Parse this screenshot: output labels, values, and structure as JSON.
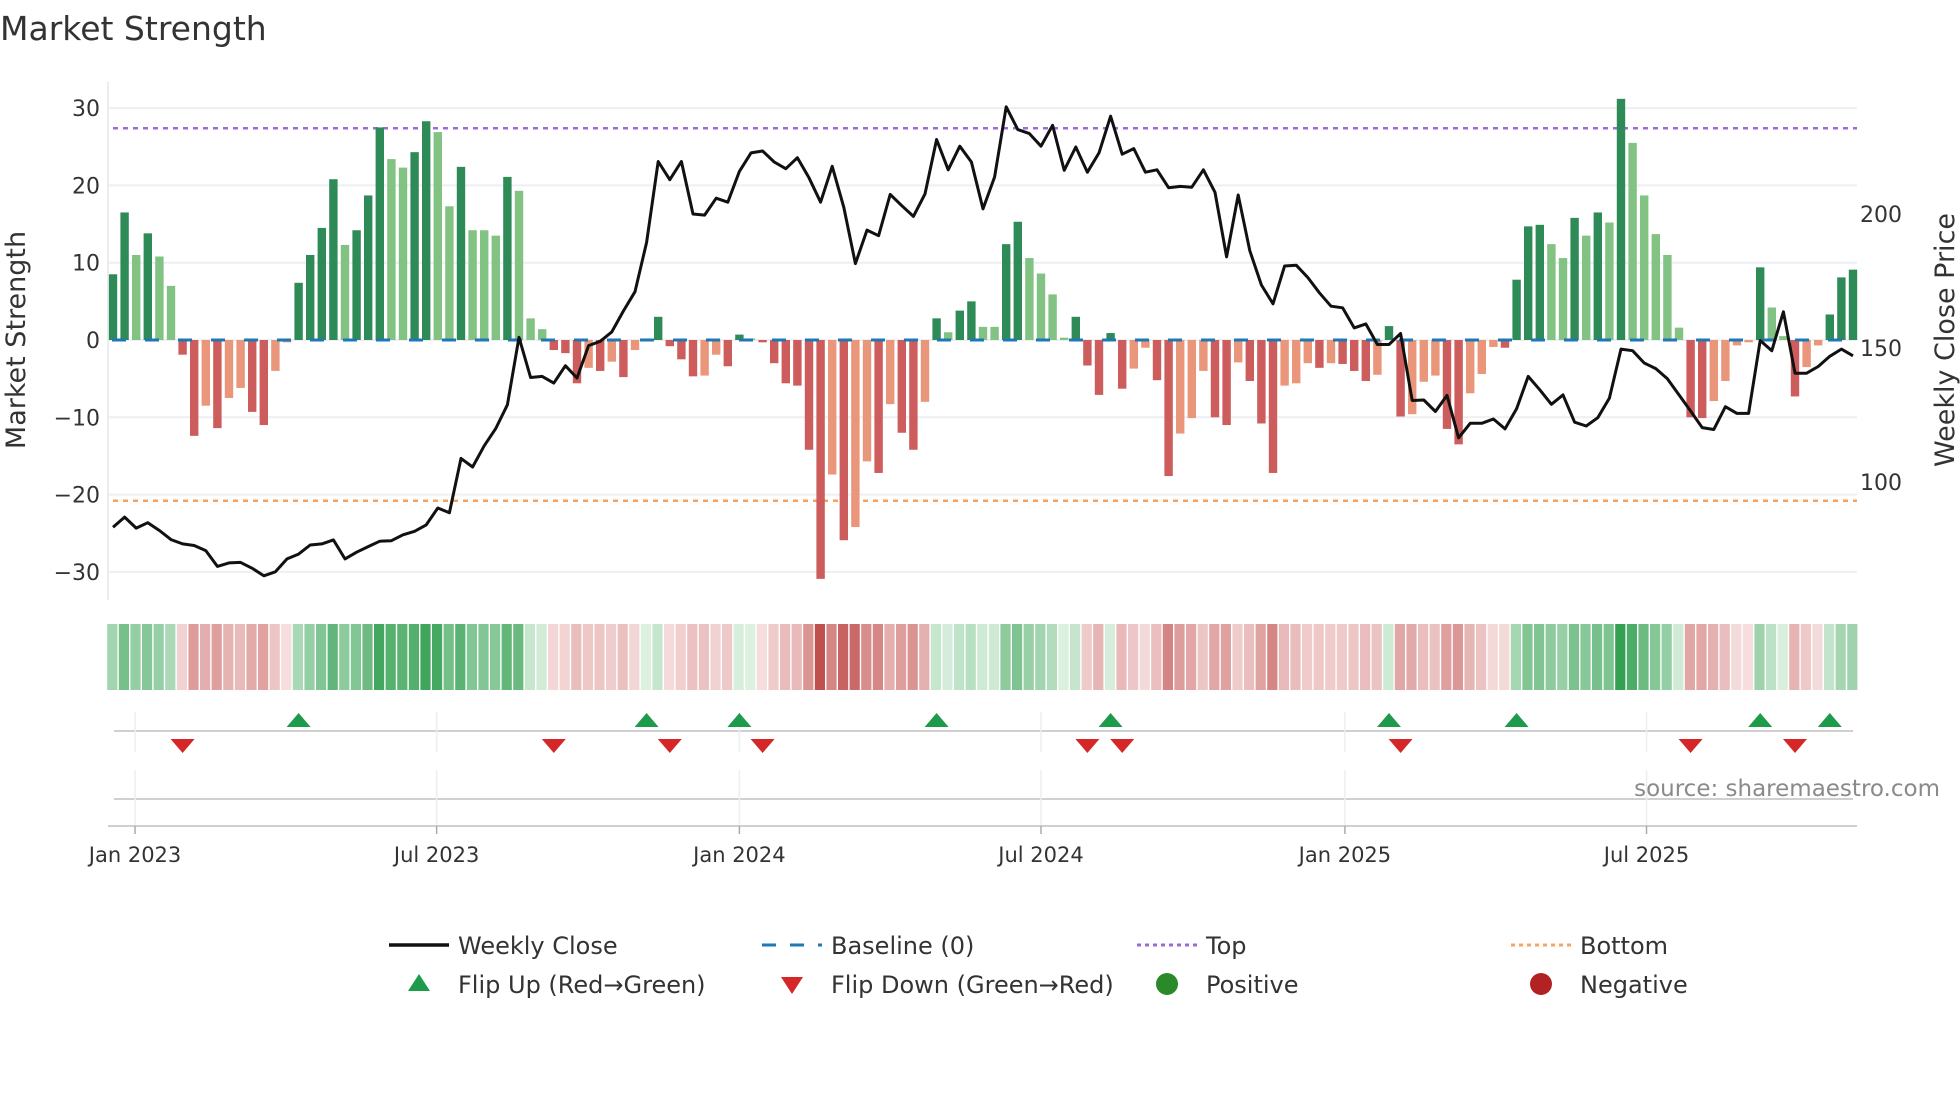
{
  "chart_data": {
    "type": "bar",
    "title": "Market Strength",
    "ylabel": "Market Strength",
    "y2label": "Weekly Close Price",
    "ylim": [
      -33.6,
      33.4
    ],
    "y2lim": [
      56,
      249
    ],
    "yticks": [
      30,
      20,
      10,
      0,
      -10,
      -20,
      -30
    ],
    "ytick_labels": [
      "30",
      "20",
      "10",
      "0",
      "−10",
      "−20",
      "−30"
    ],
    "y2ticks": [
      200,
      150,
      100
    ],
    "y2tick_labels": [
      "200",
      "150",
      "100"
    ],
    "x_unit": "week index",
    "xticks": [
      1.9,
      27.9,
      54,
      80,
      106.2,
      132.2
    ],
    "xtick_labels": [
      "Jan 2023",
      "Jul 2023",
      "Jan 2024",
      "Jul 2024",
      "Jan 2025",
      "Jul 2025"
    ],
    "top_level": 27.4,
    "bottom_level": -20.8,
    "baseline": 0,
    "series": [
      {
        "name": "Market Strength",
        "type": "bar",
        "values": [
          8.5,
          16.5,
          11,
          13.8,
          10.8,
          7,
          -1.9,
          -12.4,
          -8.5,
          -11.4,
          -7.5,
          -6.2,
          -9.3,
          -11,
          -4,
          -0.3,
          7.4,
          11,
          14.5,
          20.8,
          12.3,
          14.2,
          18.7,
          27.5,
          23.4,
          22.3,
          24.3,
          28.3,
          26.9,
          17.3,
          22.4,
          14.2,
          14.2,
          13.5,
          21.1,
          19.3,
          2.8,
          1.4,
          -1.3,
          -1.7,
          -5.6,
          -3.6,
          -4,
          -2.8,
          -4.8,
          -1.3,
          0.2,
          3,
          -0.8,
          -2.5,
          -4.7,
          -4.6,
          -1.9,
          -3.4,
          0.7,
          0.2,
          -0.3,
          -3,
          -5.6,
          -5.9,
          -14.2,
          -30.9,
          -17.4,
          -25.9,
          -24.2,
          -15.7,
          -17.2,
          -8.3,
          -12,
          -14.2,
          -8,
          2.8,
          1,
          3.8,
          5,
          1.7,
          1.7,
          12.4,
          15.3,
          10.6,
          8.6,
          5.9,
          0.3,
          3,
          -3.3,
          -7.1,
          0.9,
          -6.3,
          -3.7,
          -1,
          -5.2,
          -17.6,
          -12.1,
          -10.1,
          -4,
          -10,
          -11,
          -2.9,
          -5.3,
          -10.8,
          -17.2,
          -5.9,
          -5.6,
          -3,
          -3.6,
          -3,
          -3.1,
          -4,
          -5.3,
          -4.5,
          1.8,
          -9.9,
          -9.6,
          -5.4,
          -4.6,
          -11.5,
          -13.5,
          -6.9,
          -4.4,
          -0.9,
          -1,
          7.8,
          14.7,
          14.9,
          12.4,
          10.6,
          15.8,
          13.5,
          16.5,
          15.2,
          31.2,
          25.5,
          18.7,
          13.7,
          11,
          1.6,
          -10,
          -10.1,
          -7.9,
          -5.3,
          -0.7,
          -0.3,
          9.4,
          4.2,
          0.5,
          -7.3,
          -3.5,
          -0.7,
          3.3,
          8.1,
          9.1
        ]
      },
      {
        "name": "Weekly Close",
        "type": "line",
        "axis": "right",
        "values": [
          83.1,
          86.9,
          82.8,
          84.8,
          81.9,
          78.5,
          76.9,
          76.3,
          74.4,
          68.5,
          69.8,
          70,
          67.8,
          65,
          66.5,
          71.3,
          73.1,
          76.5,
          76.9,
          78.4,
          71.3,
          73.8,
          75.9,
          77.9,
          78.1,
          80.3,
          81.6,
          84,
          90.3,
          88.5,
          108.8,
          105.6,
          113.5,
          120,
          128.8,
          154,
          139,
          139.4,
          136.9,
          143.4,
          138.8,
          150.9,
          152.5,
          156,
          163.8,
          171,
          189.4,
          219.6,
          212.8,
          219.6,
          200,
          199.6,
          205.9,
          204.4,
          215.9,
          222.8,
          223.5,
          219.4,
          216.9,
          221,
          213.5,
          204.4,
          217.8,
          202.5,
          181.5,
          194,
          191.9,
          207.3,
          203.1,
          199.1,
          207.5,
          227.8,
          216.5,
          225.3,
          219.4,
          201.9,
          213.8,
          240,
          231.5,
          230,
          225.3,
          233.1,
          216.3,
          225,
          215.6,
          222.8,
          236.5,
          222.3,
          224.4,
          215.6,
          216.5,
          209.8,
          210.3,
          210,
          216.5,
          208.1,
          184,
          207.1,
          186.3,
          173.5,
          166.5,
          180.6,
          180.9,
          176.3,
          170.6,
          165.6,
          165,
          157.5,
          159,
          151.3,
          151.3,
          155.4,
          130.4,
          130.6,
          126.3,
          132.3,
          116.5,
          121.9,
          121.9,
          123.5,
          119.8,
          127.3,
          139.4,
          134.4,
          129,
          132.5,
          122.3,
          120.9,
          124,
          131.3,
          149.6,
          149,
          144.4,
          142.3,
          138.5,
          132.5,
          126.5,
          120.3,
          119.6,
          128.1,
          125.6,
          125.6,
          152.8,
          149,
          163.5,
          140.6,
          140.6,
          143.1,
          146.9,
          149.6,
          147.1
        ]
      }
    ],
    "flip_up_indices": [
      16,
      46,
      54,
      71,
      86,
      110,
      121,
      142,
      148
    ],
    "flip_down_indices": [
      6,
      38,
      48,
      56,
      84,
      87,
      111,
      136,
      145
    ],
    "legend": {
      "placement": "bottom",
      "items": [
        {
          "label": "Weekly Close",
          "symbol": "line-solid",
          "color": "#111111"
        },
        {
          "label": "Baseline (0)",
          "symbol": "line-dashed",
          "color": "#1f77b4"
        },
        {
          "label": "Top",
          "symbol": "line-dotted",
          "color": "#9b6bdc"
        },
        {
          "label": "Bottom",
          "symbol": "line-dotted",
          "color": "#f4a460"
        },
        {
          "label": "Flip Up (Red→Green)",
          "symbol": "triangle-up",
          "color": "#1e9b4a"
        },
        {
          "label": "Flip Down (Green→Red)",
          "symbol": "triangle-down",
          "color": "#d62728"
        },
        {
          "label": "Positive",
          "symbol": "circle",
          "color": "#2a8a2a"
        },
        {
          "label": "Negative",
          "symbol": "circle",
          "color": "#b22222"
        }
      ]
    },
    "colors": {
      "pos_strong": "#2e8b57",
      "pos_weak": "#82c282",
      "neg_strong": "#cd5c5c",
      "neg_weak": "#e9967a",
      "heat_pos_low": "#dff2e3",
      "heat_pos_high": "#34a052",
      "heat_neg_low": "#f7e2e2",
      "heat_neg_high": "#c0504d",
      "grid": "#eceff4"
    },
    "source": "source: sharemaestro.com"
  }
}
